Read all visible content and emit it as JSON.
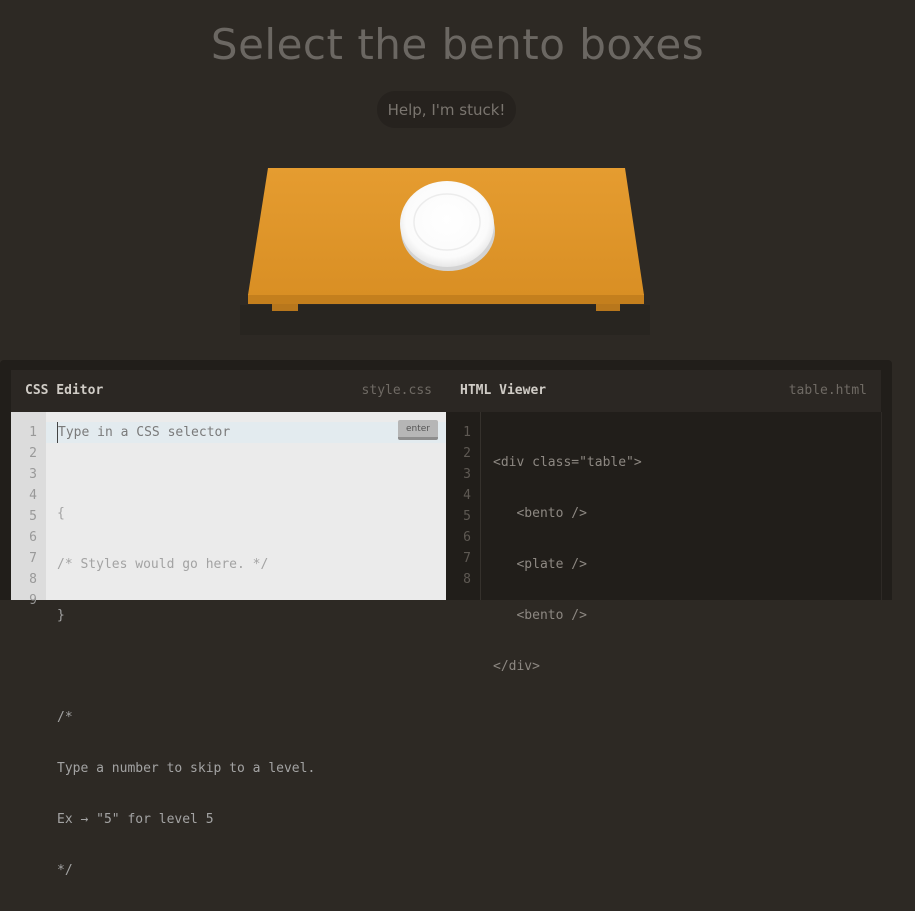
{
  "header": {
    "title": "Select the bento boxes",
    "help_label": "Help, I'm stuck!"
  },
  "scene": {
    "table_color": "#e0972d",
    "plate_color": "#ffffff",
    "items": [
      "bento",
      "plate",
      "bento"
    ]
  },
  "css_editor": {
    "title": "CSS Editor",
    "filename": "style.css",
    "input_placeholder": "Type in a CSS selector",
    "enter_label": "enter",
    "line_numbers": [
      "1",
      "2",
      "3",
      "4",
      "5",
      "6",
      "7",
      "8",
      "9"
    ],
    "lines": [
      "",
      "{",
      "/* Styles would go here. */",
      "}",
      "",
      "/*",
      "Type a number to skip to a level.",
      "Ex → \"5\" for level 5",
      "*/"
    ]
  },
  "html_viewer": {
    "title": "HTML Viewer",
    "filename": "table.html",
    "line_numbers": [
      "1",
      "2",
      "3",
      "4",
      "5",
      "6",
      "7",
      "8"
    ],
    "lines": [
      "<div class=\"table\">",
      "   <bento />",
      "   <plate />",
      "   <bento />",
      "</div>",
      "",
      "",
      ""
    ]
  }
}
